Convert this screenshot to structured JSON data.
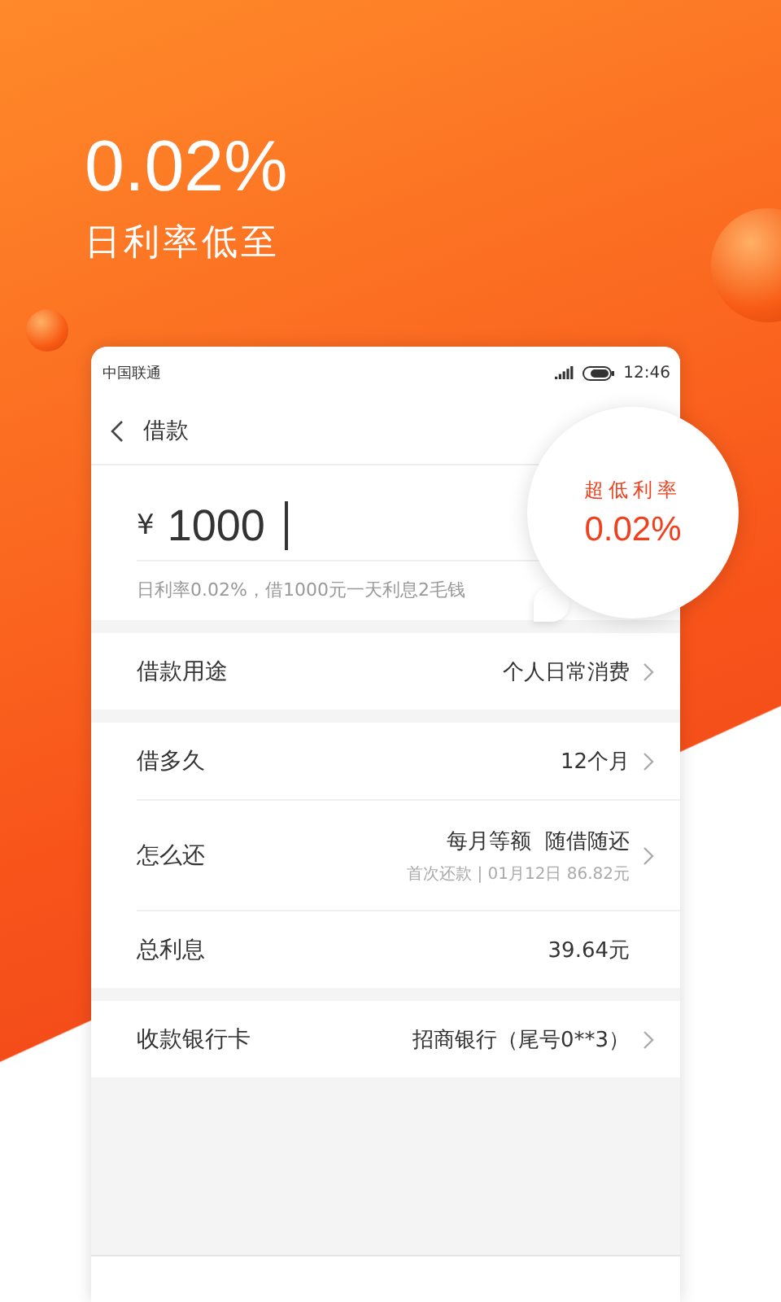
{
  "hero": {
    "rate": "0.02%",
    "caption": "日利率低至"
  },
  "status_bar": {
    "carrier": "中国联通",
    "time": "12:46"
  },
  "nav": {
    "title": "借款"
  },
  "amount": {
    "currency": "¥",
    "value": "1000",
    "hint": "日利率0.02%，借1000元一天利息2毛钱"
  },
  "bubble": {
    "label": "超低利率",
    "rate": "0.02%"
  },
  "sections": [
    {
      "rows": [
        {
          "kind": "link",
          "label": "借款用途",
          "value": "个人日常消费"
        }
      ]
    },
    {
      "rows": [
        {
          "kind": "link",
          "label": "借多久",
          "value": "12个月"
        },
        {
          "kind": "link",
          "label": "怎么还",
          "value": "每月等额  随借随还",
          "subvalue": "首次还款 | 01月12日 86.82元"
        },
        {
          "kind": "static",
          "label": "总利息",
          "value": "39.64元"
        }
      ]
    },
    {
      "rows": [
        {
          "kind": "link",
          "label": "收款银行卡",
          "value": "招商银行（尾号0**3）"
        }
      ]
    }
  ]
}
